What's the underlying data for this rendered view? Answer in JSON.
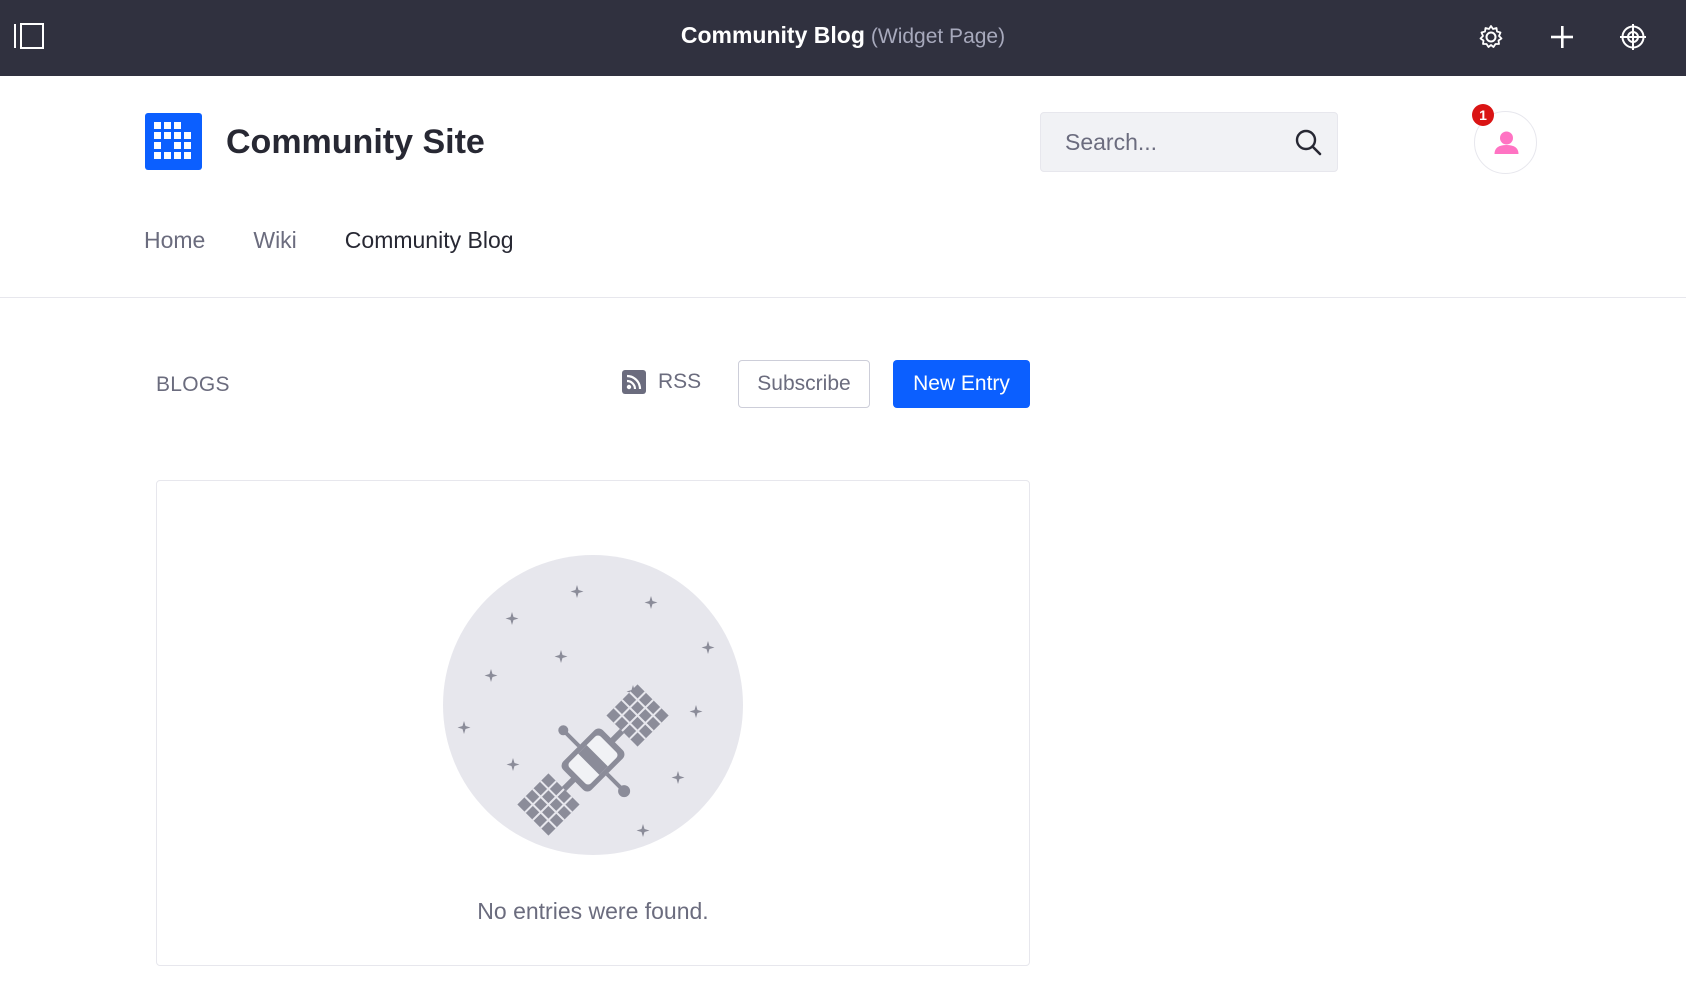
{
  "control_menu": {
    "title": "Community Blog",
    "subtitle": "(Widget Page)",
    "icons": [
      "sidebar-toggle-icon",
      "gear-icon",
      "plus-icon",
      "simulation-icon"
    ]
  },
  "header": {
    "site_name": "Community Site",
    "search_placeholder": "Search...",
    "notification_count": "1",
    "logo_color": "#0b5fff"
  },
  "nav": {
    "items": [
      {
        "label": "Home"
      },
      {
        "label": "Wiki"
      },
      {
        "label": "Community Blog"
      }
    ]
  },
  "portlet": {
    "title": "BLOGS",
    "rss_label": "RSS",
    "subscribe_label": "Subscribe",
    "new_entry_label": "New Entry",
    "empty_message": "No entries were found.",
    "accent_color": "#0b5fff"
  }
}
